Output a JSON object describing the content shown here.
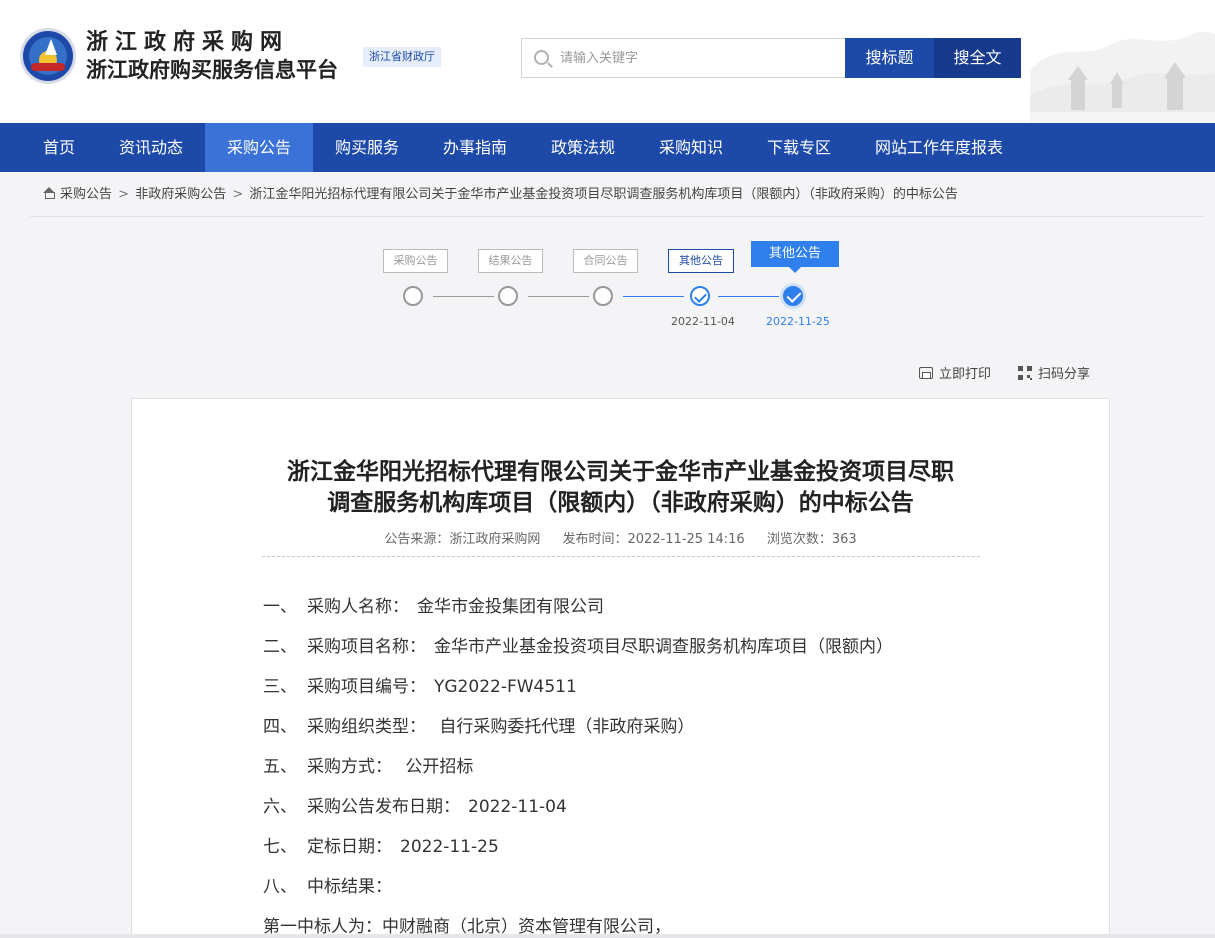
{
  "header": {
    "site_name": "浙江政府采购网",
    "site_subtitle": "浙江政府购买服务信息平台",
    "dept_badge": "浙江省财政厅",
    "search_placeholder": "请输入关键字",
    "search_title_button": "搜标题",
    "search_full_button": "搜全文"
  },
  "nav": {
    "items": [
      "首页",
      "资讯动态",
      "采购公告",
      "购买服务",
      "办事指南",
      "政策法规",
      "采购知识",
      "下载专区",
      "网站工作年度报表"
    ],
    "active_index": 2
  },
  "breadcrumb": {
    "items": [
      "采购公告",
      "非政府采购公告",
      "浙江金华阳光招标代理有限公司关于金华市产业基金投资项目尽职调查服务机构库项目（限额内）（非政府采购）的中标公告"
    ],
    "separator": ">"
  },
  "timeline": {
    "steps": [
      {
        "label": "采购公告",
        "date": ""
      },
      {
        "label": "结果公告",
        "date": ""
      },
      {
        "label": "合同公告",
        "date": ""
      },
      {
        "label": "其他公告",
        "date": "2022-11-04"
      },
      {
        "label": "其他公告",
        "date": "2022-11-25"
      }
    ]
  },
  "tools": {
    "print": "立即打印",
    "share": "扫码分享"
  },
  "article": {
    "title_line1": "浙江金华阳光招标代理有限公司关于金华市产业基金投资项目尽职",
    "title_line2": "调查服务机构库项目（限额内）（非政府采购）的中标公告",
    "source": "公告来源：浙江政府采购网",
    "publish_time": "发布时间：2022-11-25 14:16",
    "views": "浏览次数：363",
    "lines": [
      {
        "num": "一、",
        "label": "采购人名称：",
        "value": "金华市金投集团有限公司"
      },
      {
        "num": "二、",
        "label": "采购项目名称：",
        "value": "金华市产业基金投资项目尽职调查服务机构库项目（限额内）"
      },
      {
        "num": "三、",
        "label": "采购项目编号：",
        "value": "YG2022-FW4511"
      },
      {
        "num": "四、",
        "label": "采购组织类型：",
        "value": " 自行采购委托代理（非政府采购）"
      },
      {
        "num": "五、",
        "label": "采购方式：",
        "value": " 公开招标"
      },
      {
        "num": "六、",
        "label": "采购公告发布日期：",
        "value": "2022-11-04"
      },
      {
        "num": "七、",
        "label": "定标日期：",
        "value": "2022-11-25"
      },
      {
        "num": "八、",
        "label": "中标结果：",
        "value": ""
      }
    ],
    "winner_line": "第一中标人为：中财融商（北京）资本管理有限公司，"
  },
  "colors": {
    "brand_blue": "#1d4aa8",
    "nav_active": "#3a72d8",
    "accent_blue": "#2f80ed"
  }
}
